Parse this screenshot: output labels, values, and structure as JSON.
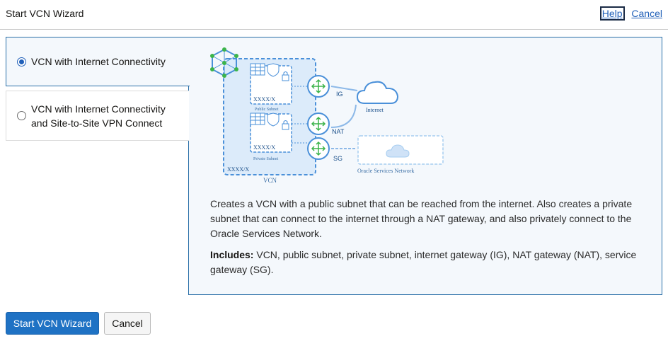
{
  "header": {
    "title": "Start VCN Wizard",
    "help_label": "Help",
    "cancel_label": "Cancel"
  },
  "options": [
    {
      "label": "VCN with Internet Connectivity",
      "selected": true
    },
    {
      "label_line1": "VCN with Internet Connectivity",
      "label_line2": "and Site-to-Site VPN Connect",
      "selected": false
    }
  ],
  "diagram": {
    "public_subnet_cidr": "XXXX/X",
    "public_subnet_label": "Public Subnet",
    "private_subnet_cidr": "XXXX/X",
    "private_subnet_label": "Private Subnet",
    "vcn_cidr": "XXXX/X",
    "vcn_label": "VCN",
    "ig_label": "IG",
    "nat_label": "NAT",
    "sg_label": "SG",
    "internet_label": "Internet",
    "osn_label": "Oracle Services Network"
  },
  "description": "Creates a VCN with a public subnet that can be reached from the internet. Also creates a private subnet that can connect to the internet through a NAT gateway, and also privately connect to the Oracle Services Network.",
  "includes_label": "Includes:",
  "includes_text": " VCN, public subnet, private subnet, internet gateway (IG), NAT gateway (NAT), service gateway (SG).",
  "footer": {
    "start_label": "Start VCN Wizard",
    "cancel_label": "Cancel"
  },
  "colors": {
    "accent": "#1f72c4",
    "link": "#1f5fb8",
    "panel_border": "#2a6fa8",
    "panel_bg": "#f4f8fc",
    "diagram_blue": "#4a90d9"
  }
}
